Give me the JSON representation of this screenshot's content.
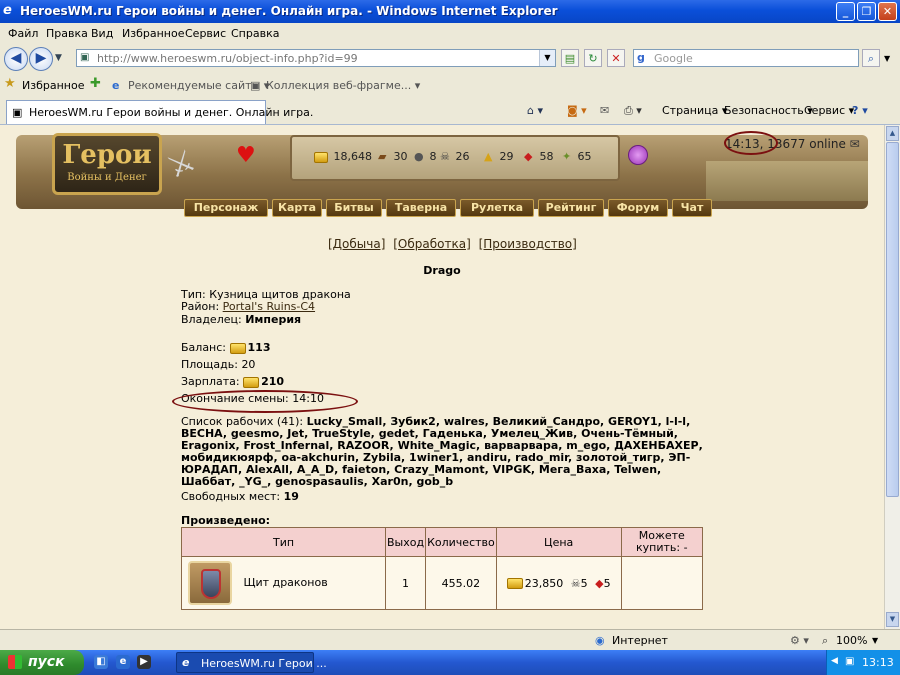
{
  "window": {
    "title": "HeroesWM.ru Герои войны и денег. Онлайн игра. - Windows Internet Explorer"
  },
  "menu": [
    "Файл",
    "Правка",
    "Вид",
    "Избранное",
    "Сервис",
    "Справка"
  ],
  "address": {
    "url": "http://www.heroeswm.ru/object-info.php?id=99",
    "search_placeholder": "Google"
  },
  "favorites": {
    "label": "Избранное",
    "items": [
      "Рекомендуемые сайты ▾",
      "Коллекция веб-фрагме... ▾"
    ]
  },
  "tab": {
    "title": "HeroesWM.ru Герои войны и денег. Онлайн игра."
  },
  "commands": [
    "Страница ▾",
    "Безопасность ▾",
    "Сервис ▾"
  ],
  "game": {
    "logo_title": "Герои",
    "logo_subtitle": "Войны и Денег",
    "resources": {
      "gold": "18,648",
      "wood": "30",
      "ore": "8",
      "mercury": "26",
      "sulfur": "29",
      "crystals": "58",
      "gems": "65"
    },
    "time": "14:13,",
    "online": "13677 online",
    "nav": [
      "Персонаж",
      "Карта",
      "Битвы",
      "Таверна",
      "Рулетка",
      "Рейтинг",
      "Форум",
      "Чат"
    ]
  },
  "page": {
    "links": [
      "[Добыча]",
      "[Обработка]",
      "[Производство]"
    ],
    "object_name": "Drago",
    "type_label": "Тип:",
    "type_value": "Кузница щитов дракона",
    "district_label": "Район:",
    "district_value": "Portal's Ruins-C4",
    "owner_label": "Владелец:",
    "owner_value": "Империя",
    "balance_label": "Баланс:",
    "balance_value": "113",
    "area_label": "Площадь:",
    "area_value": "20",
    "salary_label": "Зарплата:",
    "salary_value": "210",
    "shift_end_label": "Окончание смены:",
    "shift_end_value": "14:10",
    "workers_label": "Список рабочих (41):",
    "workers": "Lucky_Small, Зубик2, walres, Великий_Сандро, GEROY1, l-l-l, BECHA, geesmo, Jet, TrueStyle, gedet, Гаденька, Умелец_Жив, Очень-Тёмный, Eragonix, Frost_Infernal, RAZOOR, White_Magic, варварвара, m_ego, ДАХЕНБАХЕР, мобидикюярф, oa-akchurin, Zybila, 1winer1, andiru, rado_mir, золотой_тигр, ЭП-ЮРАДАП, AlexAll, A_A_D, faieton, Crazy_Mamont, VIPGK, Мега_Baxa, Telwen, Шаббат, _YG_, genospasaulis, Xar0n, gob_b",
    "free_label": "Свободных мест:",
    "free_value": "19",
    "produced_label": "Произведено:",
    "table": {
      "headers": [
        "Тип",
        "Выход",
        "Количество",
        "Цена",
        "Можете купить: -"
      ],
      "row": {
        "item": "Щит драконов",
        "output": "1",
        "quantity": "455.02",
        "price_gold": "23,850",
        "price_mercury": "5",
        "price_crystals": "5"
      }
    }
  },
  "status": {
    "zone": "Интернет",
    "zoom": "100%"
  },
  "taskbar": {
    "start": "пуск",
    "item": "HeroesWM.ru Герои ...",
    "clock": "13:13"
  }
}
